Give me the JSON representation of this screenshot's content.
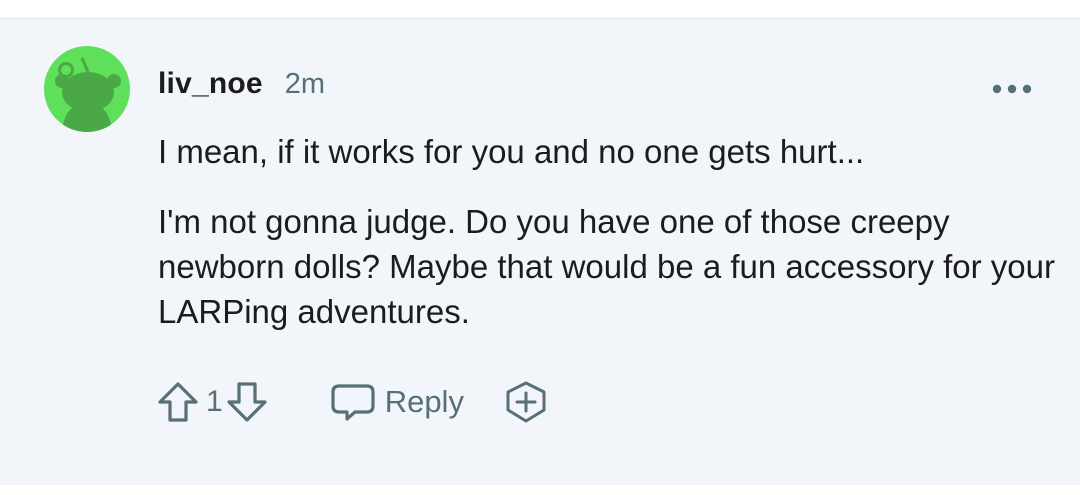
{
  "comment": {
    "avatar_icon": "reddit-snoo-avatar-icon",
    "avatar_color": "#5fe05a",
    "username": "liv_noe",
    "timestamp": "2m",
    "more_icon": "more-options-icon",
    "paragraphs": [
      "I mean, if it works for you and no one gets hurt...",
      "I'm not gonna judge. Do you have one of those creepy newborn dolls? Maybe that would be a fun accessory for your LARPing adventures."
    ],
    "actions": {
      "upvote_icon": "upvote-arrow-icon",
      "vote_count": "1",
      "downvote_icon": "downvote-arrow-icon",
      "reply_icon": "speech-bubble-icon",
      "reply_label": "Reply",
      "award_icon": "award-plus-icon"
    }
  },
  "colors": {
    "comment_background": "#f2f6fa",
    "text_primary": "#1c1c1c",
    "text_secondary": "#576f76"
  }
}
